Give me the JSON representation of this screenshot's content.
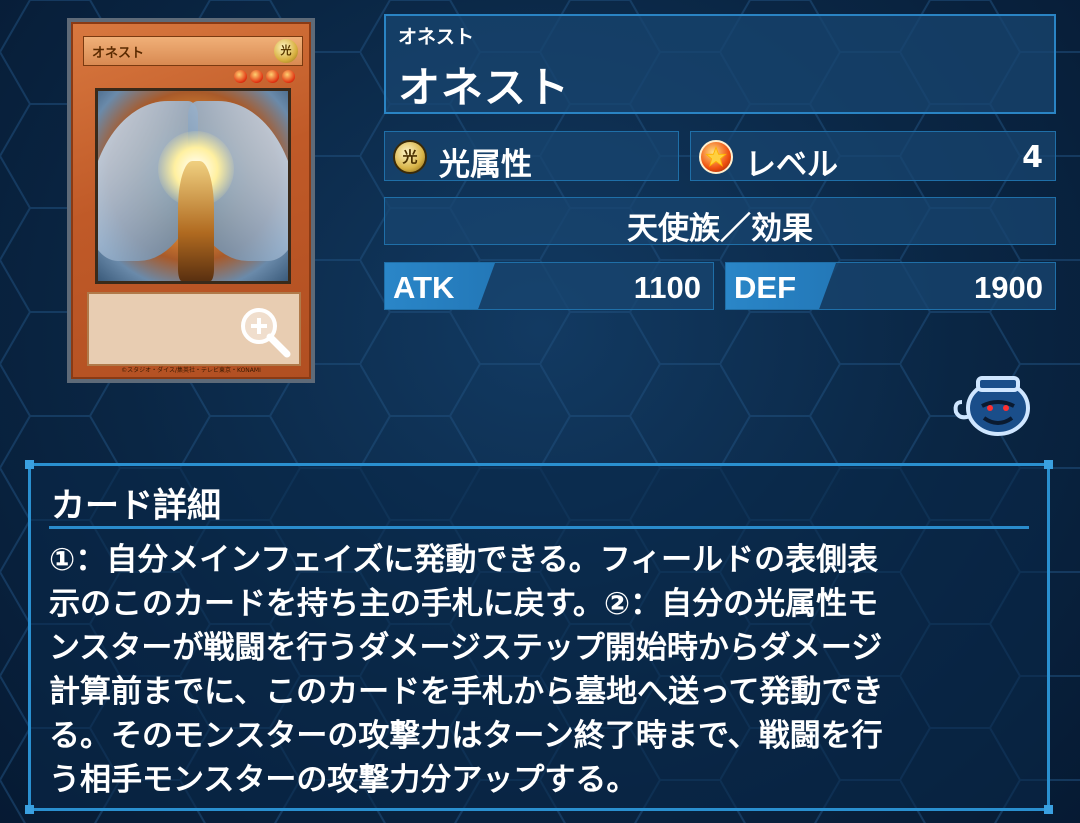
{
  "card": {
    "name_on_card": "オネスト",
    "attribute_glyph": "光",
    "level_stars": 4,
    "copyright": "©スタジオ・ダイス/集英社・テレビ東京・KONAMI"
  },
  "header": {
    "name_reading": "オネスト",
    "name": "オネスト"
  },
  "stats": {
    "attribute_icon_glyph": "光",
    "attribute_label": "光属性",
    "level_label": "レベル",
    "level_value": "4",
    "type_label": "天使族／効果",
    "atk_label": "ATK",
    "atk_value": "1100",
    "def_label": "DEF",
    "def_value": "1900"
  },
  "detail": {
    "title": "カード詳細",
    "text": "①：自分メインフェイズに発動できる。フィールドの表側表\n示のこのカードを持ち主の手札に戻す。②：自分の光属性モ\nンスターが戦闘を行うダメージステップ開始時からダメージ\n計算前までに、このカードを手札から墓地へ送って発動でき\nる。そのモンスターの攻撃力はターン終了時まで、戦闘を行\nう相手モンスターの攻撃力分アップする。"
  },
  "icons": {
    "zoom": "zoom-in-icon",
    "pot": "pot-of-greed-icon",
    "attribute": "light-attribute-icon",
    "level": "level-star-icon"
  },
  "colors": {
    "background": "#0a2644",
    "panel": "#184670",
    "border": "#2a84c4",
    "card_frame": "#c05a28"
  }
}
